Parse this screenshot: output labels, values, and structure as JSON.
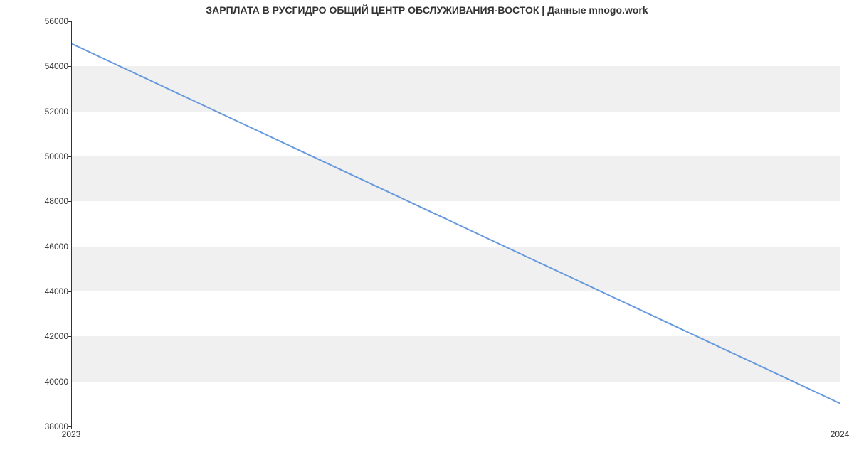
{
  "chart_data": {
    "type": "line",
    "title": "ЗАРПЛАТА В  РУСГИДРО ОБЩИЙ ЦЕНТР ОБСЛУЖИВАНИЯ-ВОСТОК | Данные mnogo.work",
    "xlabel": "",
    "ylabel": "",
    "x": [
      2023,
      2024
    ],
    "values": [
      55000,
      39000
    ],
    "x_ticks": [
      2023,
      2024
    ],
    "y_ticks": [
      38000,
      40000,
      42000,
      44000,
      46000,
      48000,
      50000,
      52000,
      54000,
      56000
    ],
    "xlim": [
      2023,
      2024
    ],
    "ylim": [
      38000,
      56000
    ],
    "line_color": "#6699dd",
    "band_color": "#f0f0f0"
  }
}
